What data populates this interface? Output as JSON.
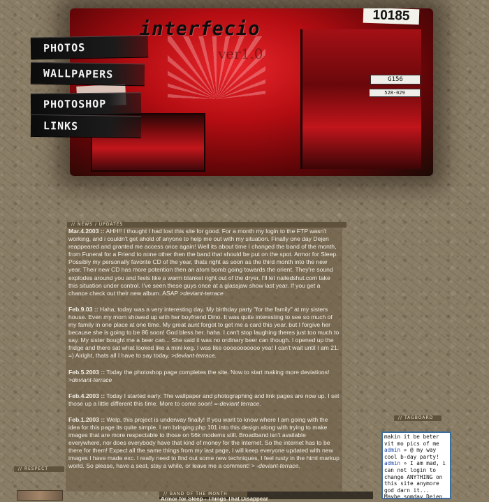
{
  "site": {
    "logo": "interfecio",
    "version": "ver1.0"
  },
  "banner": {
    "plate_number": "10185",
    "plate_code": "G156",
    "plate_small": "528-029"
  },
  "nav": {
    "items": [
      {
        "label": "PHOTOS"
      },
      {
        "label": "WALLPAPERS"
      },
      {
        "label": "PHOTOSHOP"
      },
      {
        "label": "LINKS"
      }
    ]
  },
  "news": {
    "header": "// NEWS / UPDATES",
    "entries": [
      {
        "date": "Mar.4.2003 ::",
        "text": " AHH!! I thought I had lost this site for good. For a month my login to the FTP wasn't working, and i couldn't get ahold of anyone to help me out with my situation. Finally one day Dejen reappeared and granted me access once again! Well its about time I changed the band of the month, from Funeral for a Friend to none other then the band that should be put on the spot. Armor for Sleep. Possibly my personally favorite CD of the year, thats right as soon as the third month into the new year. Their new CD has more potention then an atom bomb going towards the orient. They're sound explodes around you and feels like a warm blanket right out of the dryer. I'll let nailedshut.com take this situation under control. I've seen these guys once at a glassjaw show last year. If you get a chance check out their new album. ASAP ",
        "sig": ">deviant-terrace"
      },
      {
        "date": "Feb.9.03 ::",
        "text": " Haha, today was a very interesting day. My birthday party \"for the family\" at my sisters house. Even my mom showed up with her boyfriend Dino. It was quite interesting to see so much of my family in one place at one time. My great aunt forgot to get me a card this year, but I forgive her because she is going to be 86 soon! God bless her. haha. I can't stop laughing theres just too much to say. My sister bought me a beer can... She said it was no ordinary beer can though. I opened up the fridge and there sat what looked like a mini keg. I was like ooooooooooo yea! I can't wait until I am 21. =) Alright, thats all I have to say today. ",
        "sig": ">deviant-terrace."
      },
      {
        "date": "Feb.5.2003 ::",
        "text": " Today the photoshop page completes the site. Now to start making more deviations! ",
        "sig": ">deviant-terrace"
      },
      {
        "date": "Feb.4.2003 ::",
        "text": " Today I started early. The wallpaper and photographing and link pages are now up. I set those up a little different this time. More to come soon! =-",
        "sig": "deviant terrace."
      },
      {
        "date": "Feb.1.2003 ::",
        "text": " Welp, this project is underway finally! If you want to know where I am going with the idea for this page its quite simple. I am bringing php 101 into this design along with trying to make images that are more respectable to those on 56k modems still. Broadband isn't available everywhere, nor does everybody have that kind of money for the internet. So the internet has to be there for them! Expect all the same things from my last page, I will keep everyone updated with new images I have made exc. I really need to find out some new techniques, I feel rusty in the html markup world. So please, have a seat, stay a while, or leave me a comment! > -",
        "sig": "deviant-terrace."
      }
    ]
  },
  "sidebar": {
    "respect_label": "// RESPECT",
    "tagboard_label": "// TAGBOARD",
    "band_label": "// BAND OF THE MONTH",
    "band_name": "Armor for Sleep - Things That Disappear"
  },
  "tagboard": {
    "lines": [
      {
        "type": "text",
        "value": "makin it be beter vit mo pics of me"
      },
      {
        "type": "name",
        "value": "admin"
      },
      {
        "type": "text",
        "value": "» @ my way cool b-day party!"
      },
      {
        "type": "name",
        "value": "admin"
      },
      {
        "type": "text",
        "value": "» I am mad, i can not login to change ANYTHING on this site anymore god darn it... Maybe somday Dejen will help me out again. sucks! at this"
      }
    ]
  },
  "colors": {
    "background": "#8a7d66",
    "banner_red": "#c2161c",
    "news_text": "#f3efe4",
    "tag_link": "#1a47a8"
  }
}
